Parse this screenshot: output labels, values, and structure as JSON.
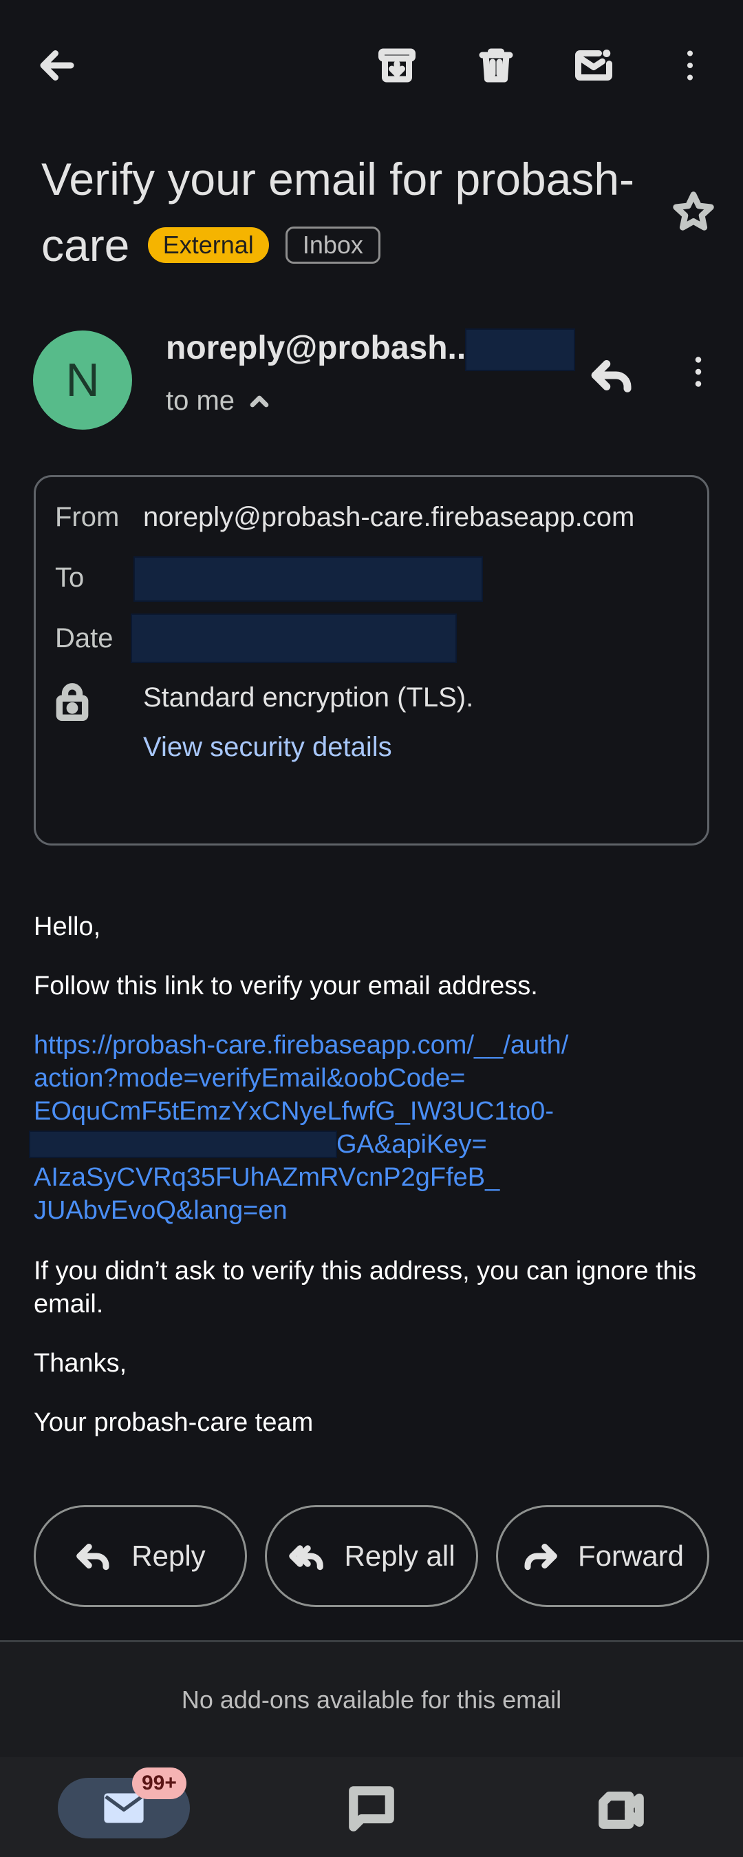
{
  "toolbar": {
    "back_icon": "arrow-left-icon",
    "archive_icon": "archive-icon",
    "delete_icon": "trash-icon",
    "mark_unread_icon": "mail-unread-icon",
    "more_icon": "more-vert-icon"
  },
  "subject": {
    "title": "Verify your email for probash-care",
    "external_label": "External",
    "inbox_label": "Inbox"
  },
  "sender": {
    "avatar_letter": "N",
    "name": "noreply@probash...",
    "recipient_label": "to me",
    "avatar_color": "#57bb8a"
  },
  "details": {
    "from_label": "From",
    "from_value": "noreply@probash-care.firebaseapp.com",
    "to_label": "To",
    "date_label": "Date",
    "encryption": "Standard encryption (TLS).",
    "security_link": "View security details"
  },
  "body": {
    "greeting": "Hello,",
    "instruction": "Follow this link to verify your email address.",
    "link_lines": [
      "https://probash-care.firebaseapp.com/__/auth/",
      "action?mode=verifyEmail&oobCode=",
      "EOquCmF5tEmzYxCNyeLfwfG_IW3UC1to0-",
      "GA&apiKey=",
      "AIzaSyCVRq35FUhAZmRVcnP2gFfeB_",
      "JUAbvEvoQ&lang=en"
    ],
    "ignore_text": "If you didn’t ask to verify this address, you can ignore this email.",
    "thanks": "Thanks,",
    "signature": "Your probash-care team"
  },
  "actions": {
    "reply": "Reply",
    "reply_all": "Reply all",
    "forward": "Forward"
  },
  "addons_text": "No add-ons available for this email",
  "bottom_nav": {
    "mail_badge": "99+",
    "accent_color": "#3c4a5e"
  }
}
